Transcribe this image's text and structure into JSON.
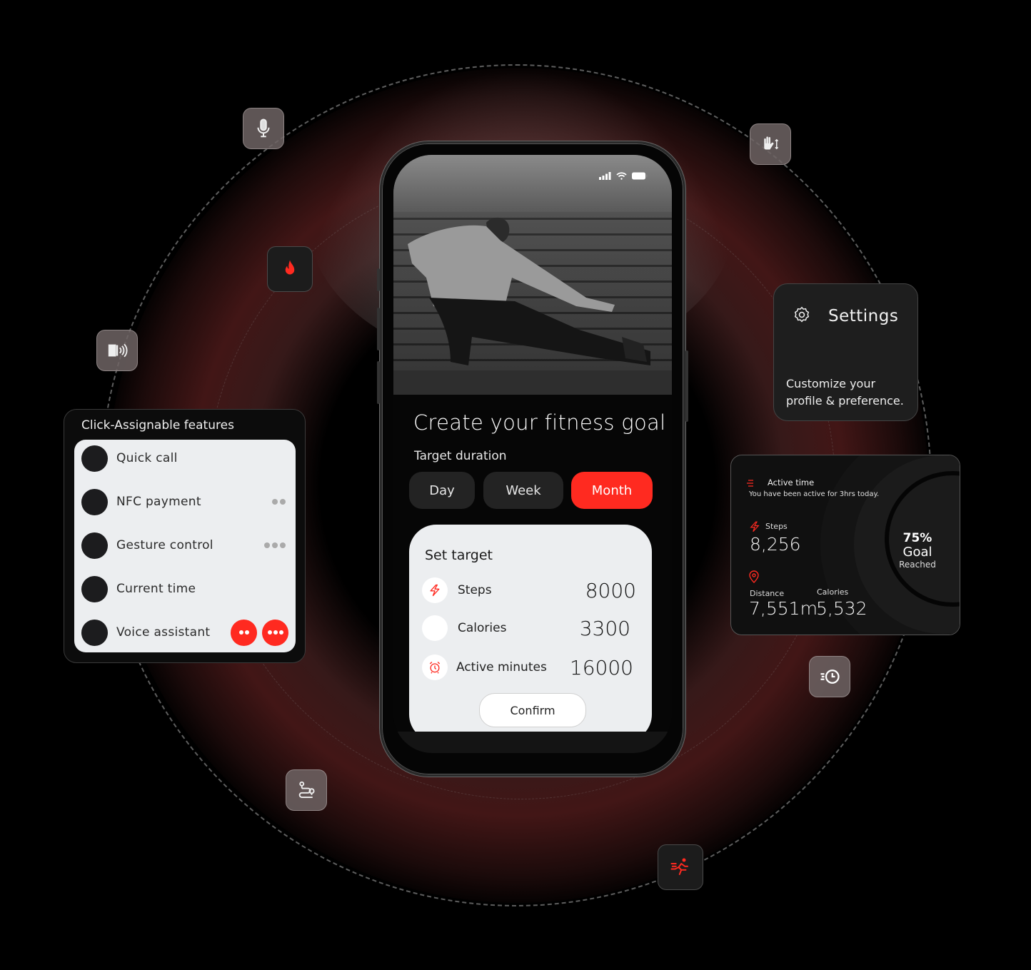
{
  "phone": {
    "status_icons": [
      "signal-icon",
      "wifi-icon",
      "battery-icon"
    ],
    "title": "Create your fitness goal",
    "duration_label": "Target duration",
    "durations": [
      {
        "label": "Day",
        "active": false
      },
      {
        "label": "Week",
        "active": false
      },
      {
        "label": "Month",
        "active": true
      }
    ],
    "target_card": {
      "header": "Set target",
      "rows": [
        {
          "icon": "lightning-icon",
          "label": "Steps",
          "value": "8000"
        },
        {
          "icon": "blank-icon",
          "label": "Calories",
          "value": "3300"
        },
        {
          "icon": "alarm-clock-icon",
          "label": "Active minutes",
          "value": "16000"
        }
      ],
      "confirm_label": "Confirm"
    }
  },
  "assignable": {
    "title": "Click-Assignable features",
    "items": [
      {
        "label": "Quick call"
      },
      {
        "label": "NFC payment",
        "indicator": "double-press"
      },
      {
        "label": "Gesture control",
        "indicator": "triple-press"
      },
      {
        "label": "Current time"
      },
      {
        "label": "Voice assistant",
        "indicator": "double-and-triple-press-active"
      }
    ]
  },
  "settings": {
    "title": "Settings",
    "description": "Customize your profile & preference."
  },
  "activity": {
    "header": "Active time",
    "subtitle": "You have been active for 3hrs today.",
    "steps_label": "Steps",
    "steps_value": "8,256",
    "distance_label": "Distance",
    "distance_value": "7,551m",
    "calories_label": "Calories",
    "calories_value": "5,532",
    "goal_percent_label": "75%",
    "goal_progress": 0.75,
    "goal_word": "Goal",
    "goal_reached": "Reached"
  },
  "floating_icons": [
    "microphone-icon",
    "hand-gesture-icon",
    "fire-icon",
    "nfc-card-icon",
    "fast-clock-icon",
    "route-icon",
    "running-icon"
  ],
  "colors": {
    "accent": "#ff2a20",
    "card_light": "#eceef0",
    "card_dark": "#1e1e1e"
  }
}
